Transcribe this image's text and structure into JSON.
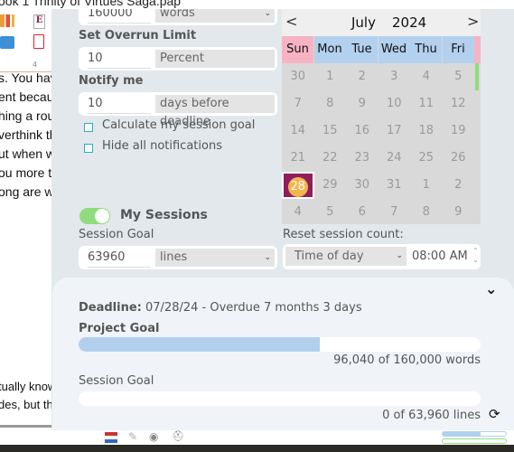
{
  "window": {
    "title": "ook 1 Trinity of Virtues Saga.pap"
  },
  "document": {
    "lines": [
      "s. You have",
      "ent becaus",
      "hing a rou",
      "verthink th",
      "ut when w",
      "ou more th",
      "ong are we"
    ],
    "lower_lines": [
      "tually know",
      "des, but th"
    ],
    "ruler_mark": "4"
  },
  "project": {
    "goal_value": "160000",
    "goal_unit": "words"
  },
  "overrun": {
    "label": "Set Overrun Limit",
    "value": "10",
    "unit": "Percent"
  },
  "notify": {
    "label": "Notify me",
    "value": "10",
    "unit": "days before deadline"
  },
  "options": {
    "calc_session": "Calculate my session goal",
    "hide_notifications": "Hide all notifications",
    "calc_checked": false,
    "hide_checked": false
  },
  "calendar": {
    "month": "July",
    "year": "2024",
    "weekdays": [
      "Sun",
      "Mon",
      "Tue",
      "Wed",
      "Thu",
      "Fri"
    ],
    "weeks": [
      [
        "30",
        "1",
        "2",
        "3",
        "4",
        "5"
      ],
      [
        "7",
        "8",
        "9",
        "10",
        "11",
        "12"
      ],
      [
        "14",
        "15",
        "16",
        "17",
        "18",
        "19"
      ],
      [
        "21",
        "22",
        "23",
        "24",
        "25",
        "26"
      ],
      [
        "28",
        "29",
        "30",
        "31",
        "1",
        "2"
      ],
      [
        "4",
        "5",
        "6",
        "7",
        "8",
        "9"
      ]
    ],
    "highlighted": "28",
    "sunday_color": "#f7b3c4",
    "weekday_color": "#b3d0ee",
    "highlight_color": "#8e1f5c"
  },
  "sessions": {
    "toggle_on": true,
    "title": "My Sessions",
    "goal_label": "Session Goal",
    "goal_value": "63960",
    "goal_unit": "lines",
    "reset_label": "Reset session count:",
    "reset_mode": "Time of day",
    "reset_time": "08:00 AM"
  },
  "summary": {
    "deadline_label": "Deadline:",
    "deadline_text": "07/28/24 - Overdue 7 months 3 days",
    "project_label": "Project Goal",
    "project_progress": 0.6,
    "project_count": "96,040 of 160,000 words",
    "session_label": "Session Goal",
    "session_progress": 0,
    "session_count": "0 of 63,960 lines"
  }
}
